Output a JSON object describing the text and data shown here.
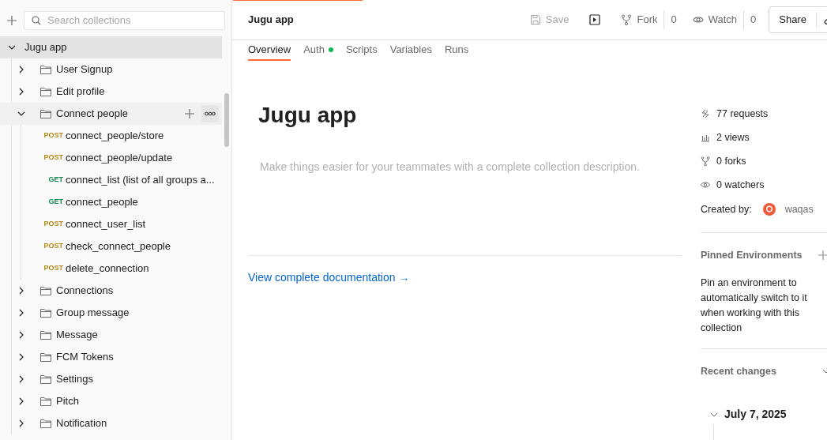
{
  "sidebar": {
    "search": {
      "placeholder": "Search collections"
    },
    "tree": [
      {
        "kind": "collection",
        "label": "Jugu app",
        "expanded": true,
        "selected": true,
        "hovered": false,
        "children": [
          {
            "kind": "folder",
            "label": "User Signup",
            "expanded": false,
            "selected": false,
            "hovered": false
          },
          {
            "kind": "folder",
            "label": "Edit profile",
            "expanded": false,
            "selected": false,
            "hovered": false
          },
          {
            "kind": "folder",
            "label": "Connect people",
            "expanded": true,
            "selected": false,
            "hovered": true,
            "children": [
              {
                "kind": "request",
                "method": "POST",
                "color": "#b58a1b",
                "label": "connect_people/store",
                "selected": false,
                "hovered": false
              },
              {
                "kind": "request",
                "method": "POST",
                "color": "#b58a1b",
                "label": "connect_people/update",
                "selected": false,
                "hovered": false
              },
              {
                "kind": "request",
                "method": "GET",
                "color": "#0f8a4a",
                "label": "connect_list (list of all groups a...",
                "selected": false,
                "hovered": false
              },
              {
                "kind": "request",
                "method": "GET",
                "color": "#0f8a4a",
                "label": "connect_people",
                "selected": false,
                "hovered": false
              },
              {
                "kind": "request",
                "method": "POST",
                "color": "#b58a1b",
                "label": "connect_user_list",
                "selected": false,
                "hovered": false
              },
              {
                "kind": "request",
                "method": "POST",
                "color": "#b58a1b",
                "label": "check_connect_people",
                "selected": false,
                "hovered": false
              },
              {
                "kind": "request",
                "method": "POST",
                "color": "#b58a1b",
                "label": "delete_connection",
                "selected": false,
                "hovered": false
              }
            ]
          },
          {
            "kind": "folder",
            "label": "Connections",
            "expanded": false,
            "selected": false,
            "hovered": false
          },
          {
            "kind": "folder",
            "label": "Group message",
            "expanded": false,
            "selected": false,
            "hovered": false
          },
          {
            "kind": "folder",
            "label": "Message",
            "expanded": false,
            "selected": false,
            "hovered": false
          },
          {
            "kind": "folder",
            "label": "FCM Tokens",
            "expanded": false,
            "selected": false,
            "hovered": false
          },
          {
            "kind": "folder",
            "label": "Settings",
            "expanded": false,
            "selected": false,
            "hovered": false
          },
          {
            "kind": "folder",
            "label": "Pitch",
            "expanded": false,
            "selected": false,
            "hovered": false
          },
          {
            "kind": "folder",
            "label": "Notification",
            "expanded": false,
            "selected": false,
            "hovered": false
          }
        ]
      }
    ]
  },
  "header": {
    "title": "Jugu app",
    "actions": [
      {
        "kind": "save",
        "label": "Save",
        "disabled": true
      },
      {
        "kind": "run"
      },
      {
        "kind": "fork",
        "label": "Fork",
        "count": "0"
      },
      {
        "kind": "watch",
        "label": "Watch",
        "count": "0"
      },
      {
        "kind": "share",
        "label": "Share"
      }
    ]
  },
  "tabs": [
    {
      "label": "Overview",
      "selected": true,
      "dot": false
    },
    {
      "label": "Auth",
      "selected": false,
      "dot": true
    },
    {
      "label": "Scripts",
      "selected": false,
      "dot": false
    },
    {
      "label": "Variables",
      "selected": false,
      "dot": false
    },
    {
      "label": "Runs",
      "selected": false,
      "dot": false
    }
  ],
  "overview": {
    "title": "Jugu app",
    "description": {
      "placeholder": "Make things easier for your teammates with a complete collection description."
    },
    "doc_link": "View complete documentation →"
  },
  "stats": [
    {
      "kind": "requests",
      "text": "77 requests"
    },
    {
      "kind": "views",
      "text": "2 views"
    },
    {
      "kind": "forks",
      "text": "0 forks"
    },
    {
      "kind": "watchers",
      "text": "0 watchers"
    }
  ],
  "created_by": {
    "label": "Created by:",
    "user": "waqas"
  },
  "pinned_environments": {
    "title": "Pinned Environments",
    "text": "Pin an environment to automatically switch to it when working with this collection"
  },
  "recent_changes": {
    "title": "Recent changes",
    "groups": [
      {
        "date": "July 7, 2025"
      }
    ]
  }
}
